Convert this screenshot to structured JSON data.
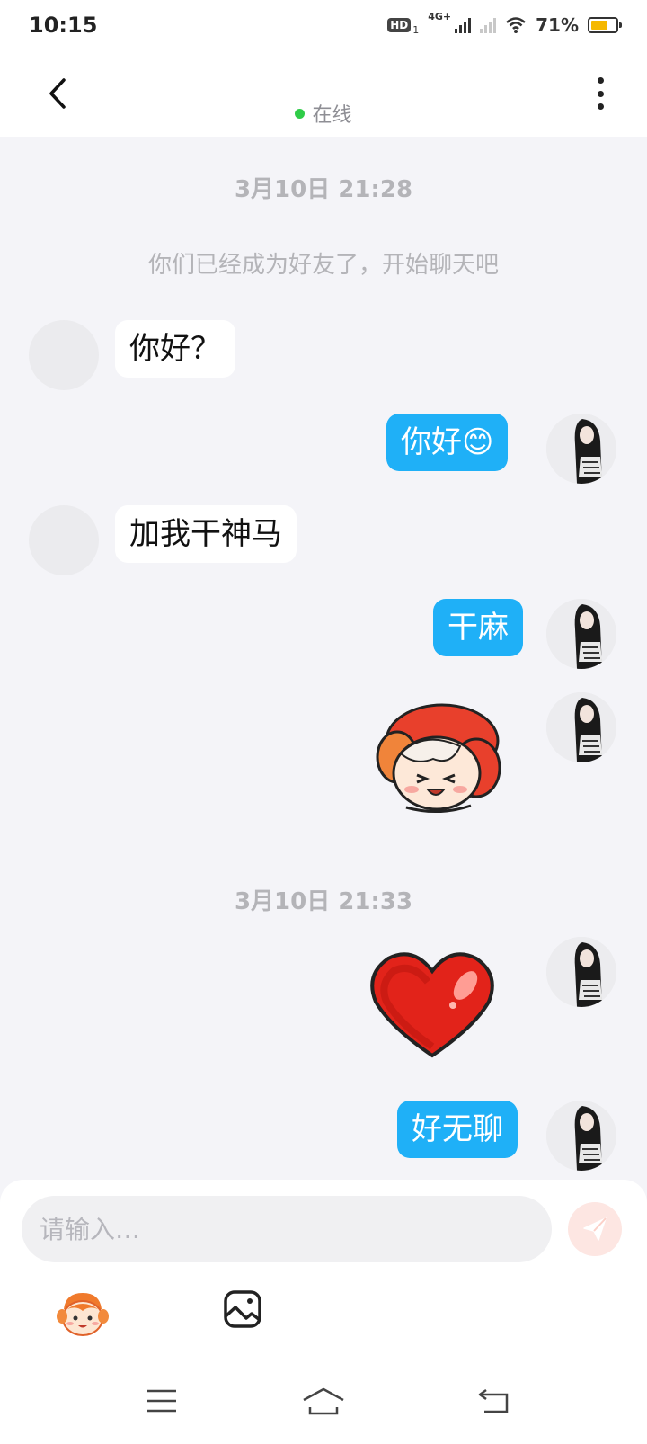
{
  "status_bar": {
    "time": "10:15",
    "hd": "HD",
    "hd_sub": "1",
    "network": "4G+",
    "battery_percent_label": "71%",
    "battery_level": 0.71
  },
  "header": {
    "status_text": "在线",
    "status_color": "#2fcc48"
  },
  "chat": {
    "timestamps": [
      "3月10日 21:28",
      "3月10日 21:33"
    ],
    "system_note": "你们已经成为好友了，开始聊天吧",
    "messages": [
      {
        "side": "left",
        "type": "text",
        "text": "你好？"
      },
      {
        "side": "right",
        "type": "text",
        "text": "你好😊"
      },
      {
        "side": "left",
        "type": "text",
        "text": "加我干神马"
      },
      {
        "side": "right",
        "type": "text",
        "text": "干麻"
      },
      {
        "side": "right",
        "type": "sticker",
        "sticker": "cartoon-girl-sticker"
      },
      {
        "side": "right",
        "type": "sticker",
        "sticker": "red-heart-sticker"
      },
      {
        "side": "right",
        "type": "text",
        "text": "好无聊"
      }
    ],
    "accent_color": "#1fb0f7"
  },
  "input": {
    "placeholder": "请输入…",
    "value": ""
  },
  "toolbar": {
    "icons": [
      "emoji-sticker-icon",
      "image-icon"
    ]
  },
  "nav": {
    "icons": [
      "menu-icon",
      "home-icon",
      "back-nav-icon"
    ]
  }
}
